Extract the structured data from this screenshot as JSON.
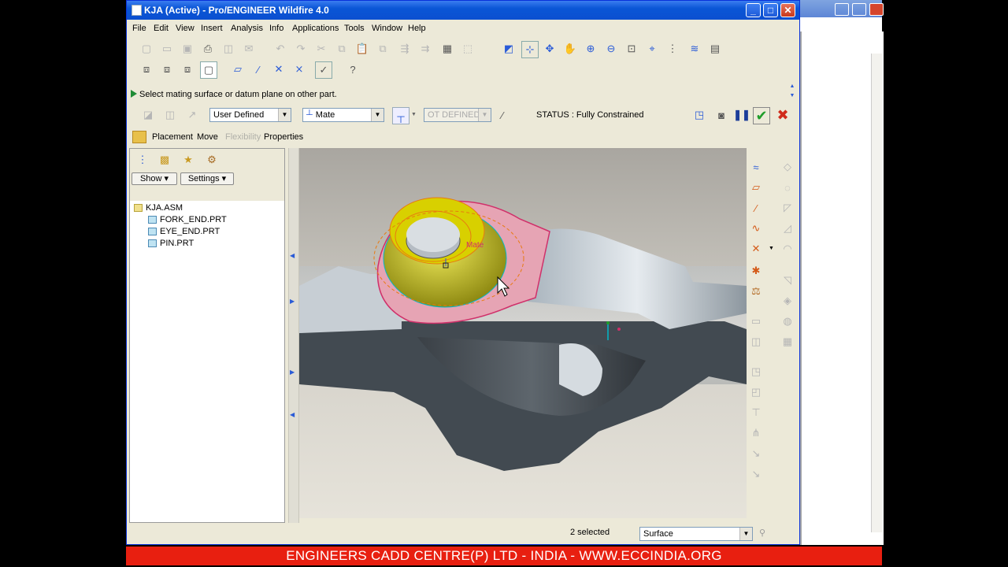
{
  "window": {
    "title": "KJA (Active) - Pro/ENGINEER Wildfire 4.0"
  },
  "menu": [
    "File",
    "Edit",
    "View",
    "Insert",
    "Analysis",
    "Info",
    "Applications",
    "Tools",
    "Window",
    "Help"
  ],
  "message": "Select mating surface or datum plane on other part.",
  "dashboard": {
    "constraint_set": "User Defined",
    "constraint_type": "Mate",
    "offset": "OT DEFINED",
    "status": "STATUS : Fully Constrained"
  },
  "tabs": [
    "Placement",
    "Move",
    "Flexibility",
    "Properties"
  ],
  "tree": {
    "show_label": "Show",
    "settings_label": "Settings",
    "root": "KJA.ASM",
    "items": [
      "FORK_END.PRT",
      "EYE_END.PRT",
      "PIN.PRT"
    ]
  },
  "viewport": {
    "constraint_tag": "Mate"
  },
  "statusbar": {
    "selected": "2 selected",
    "filter": "Surface"
  },
  "banner": "ENGINEERS CADD CENTRE(P) LTD - INDIA - WWW.ECCINDIA.ORG",
  "colors": {
    "titlebar": "#0a56d6",
    "banner": "#e81f10",
    "accent_yellow": "#d8d000",
    "accent_pink": "#e6a4b4"
  }
}
